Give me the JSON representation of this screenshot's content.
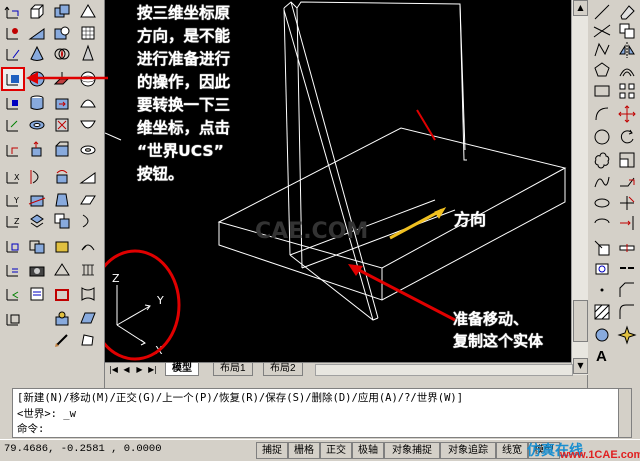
{
  "annotation_main": {
    "lines": [
      "按三维坐标原",
      "方向，是不能",
      "进行准备进行",
      "的操作，因此",
      "要转换一下三",
      "维坐标，点击",
      "“世界UCS”",
      "按钮。"
    ]
  },
  "annotation_direction": "方向",
  "annotation_move": [
    "准备移动、",
    "复制这个实体"
  ],
  "watermark_canvas": "CAE.COM",
  "ucs_axes": {
    "z": "Z",
    "y": "Y",
    "x": "X"
  },
  "layout_tabs": [
    "模型",
    "布局1",
    "布局2"
  ],
  "command_line": {
    "options": "[新建(N)/移动(M)/正交(G)/上一个(P)/恢复(R)/保存(S)/删除(D)/应用(A)/?/世界(W)]",
    "current": "<世界>: _w",
    "prompt": "命令:"
  },
  "status_bar": {
    "coordinates": "79.4686,  -0.2581 , 0.0000",
    "buttons": [
      "捕捉",
      "栅格",
      "正交",
      "极轴",
      "对象捕捉",
      "对象追踪",
      "线宽",
      "模型"
    ]
  },
  "watermark": {
    "text": "仿真在线",
    "url": "www.1CAE.com"
  },
  "colors": {
    "annotation": "#ffffff",
    "arrow_red": "#e00000",
    "arrow_yellow": "#f0c020",
    "wireframe": "#ffffff",
    "canvas": "#000000"
  }
}
